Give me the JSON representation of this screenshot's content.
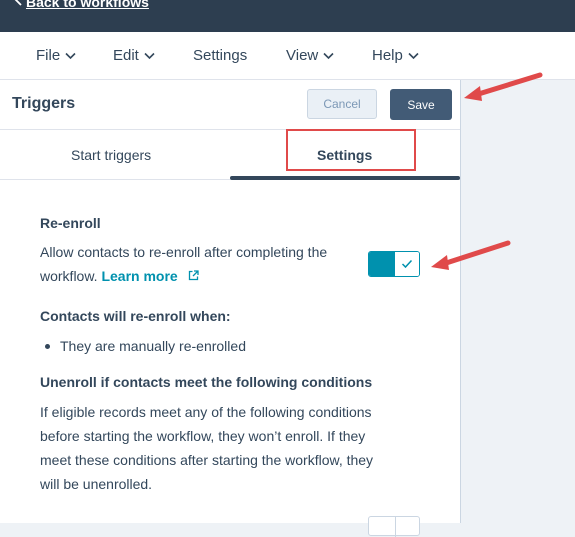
{
  "topbar": {
    "back_label": "Back to workflows"
  },
  "menu": {
    "file": "File",
    "edit": "Edit",
    "settings": "Settings",
    "view": "View",
    "help": "Help"
  },
  "panel": {
    "title": "Triggers",
    "cancel_label": "Cancel",
    "save_label": "Save",
    "tabs": [
      {
        "label": "Start triggers"
      },
      {
        "label": "Settings"
      }
    ]
  },
  "reenroll": {
    "heading": "Re-enroll",
    "desc_line1": "Allow contacts to re-enroll after completing the",
    "desc_line2": "workflow.",
    "learn_more": "Learn more",
    "toggle_on": true
  },
  "when": {
    "heading": "Contacts will re-enroll when:",
    "bullet": "They are manually re-enrolled"
  },
  "unenroll": {
    "heading": "Unenroll if contacts meet the following conditions",
    "line1": "If eligible records meet any of the following conditions",
    "line2": "before starting the workflow, they won’t enroll. If they",
    "line3": "meet these conditions after starting the workflow, they",
    "line4": "will be unenrolled."
  },
  "colors": {
    "topbar": "#2d3e50",
    "accent": "#0091ae",
    "save": "#425b76",
    "annotation": "#e04a4a"
  }
}
